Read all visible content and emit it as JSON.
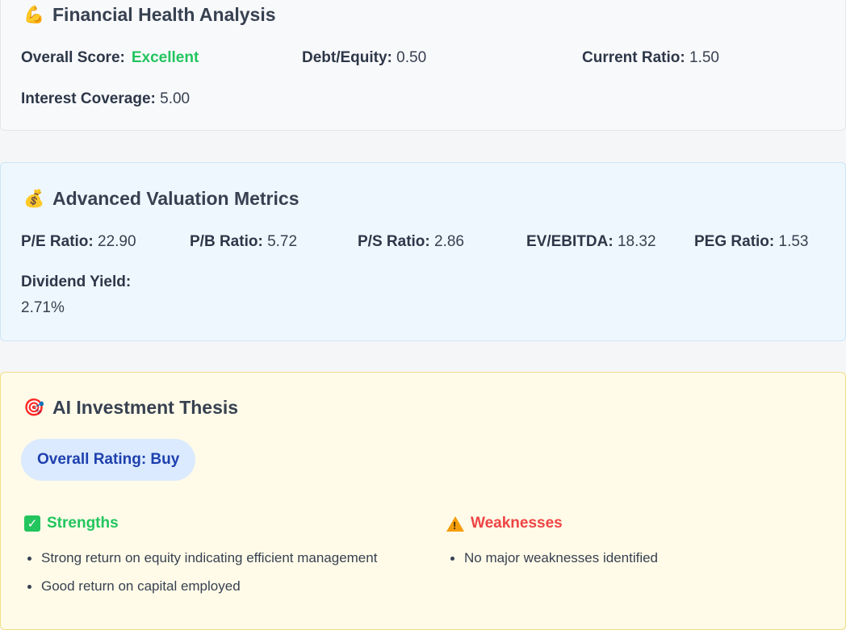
{
  "health": {
    "icon": "flexed-biceps-icon",
    "emoji": "💪",
    "title": "Financial Health Analysis",
    "overall_score_label": "Overall Score:",
    "overall_score_value": "Excellent",
    "debt_equity_label": "Debt/Equity:",
    "debt_equity_value": "0.50",
    "current_ratio_label": "Current Ratio:",
    "current_ratio_value": "1.50",
    "interest_coverage_label": "Interest Coverage:",
    "interest_coverage_value": "5.00"
  },
  "valuation": {
    "icon": "money-bag-icon",
    "emoji": "💰",
    "title": "Advanced Valuation Metrics",
    "metrics": [
      {
        "label": "P/E Ratio:",
        "value": "22.90"
      },
      {
        "label": "P/B Ratio:",
        "value": "5.72"
      },
      {
        "label": "P/S Ratio:",
        "value": "2.86"
      },
      {
        "label": "EV/EBITDA:",
        "value": "18.32"
      },
      {
        "label": "PEG Ratio:",
        "value": "1.53"
      },
      {
        "label": "Dividend Yield:",
        "value": "2.71%"
      }
    ]
  },
  "thesis": {
    "icon": "target-icon",
    "emoji": "🎯",
    "title": "AI Investment Thesis",
    "rating": "Overall Rating: Buy",
    "strengths_title": "Strengths",
    "strengths": [
      "Strong return on equity indicating efficient management",
      "Good return on capital employed"
    ],
    "weaknesses_title": "Weaknesses",
    "weaknesses": [
      "No major weaknesses identified"
    ]
  },
  "colors": {
    "excellent": "#22c55e",
    "strengths": "#22c55e",
    "weaknesses": "#ef4444",
    "rating_text": "#1e40af",
    "rating_bg": "#dbeafe"
  }
}
